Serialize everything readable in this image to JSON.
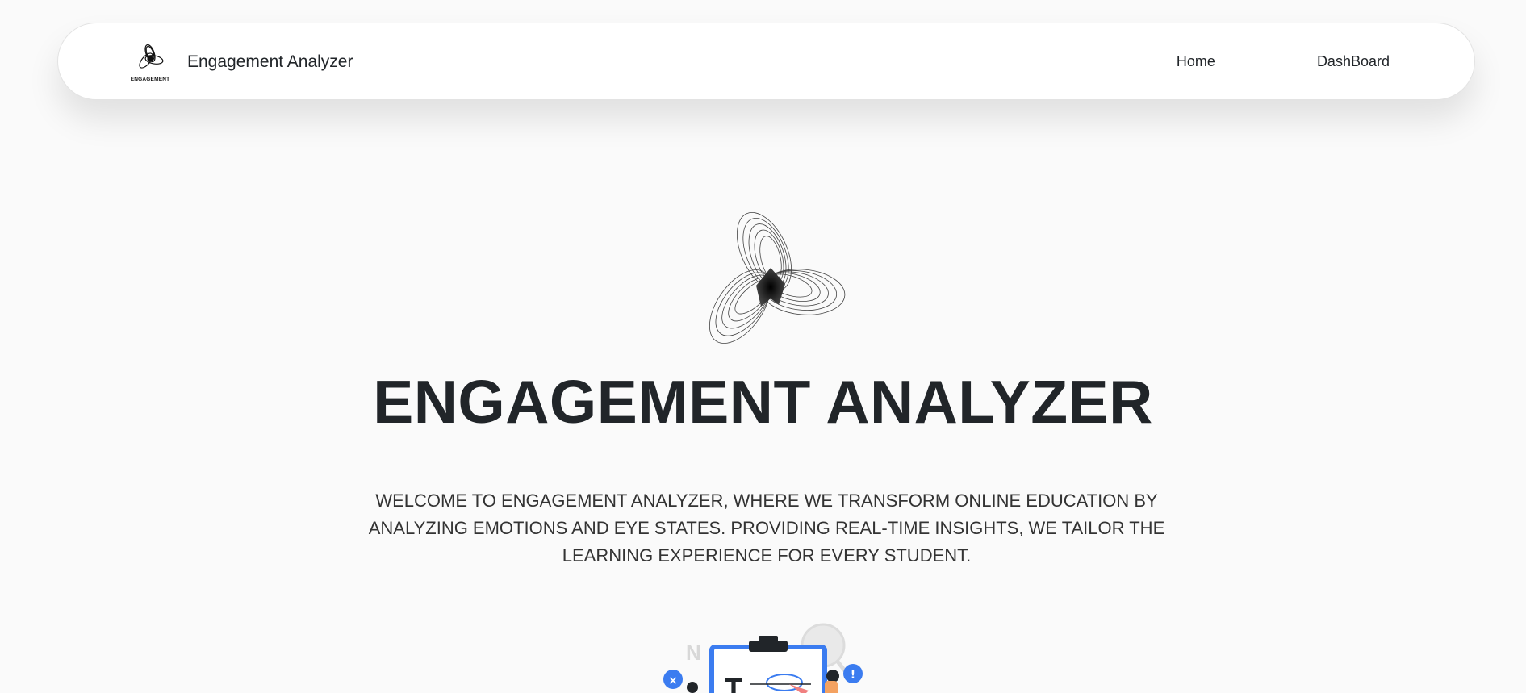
{
  "navbar": {
    "brand_logo_text": "ENGAGEMENT",
    "brand_name": "Engagement Analyzer",
    "links": [
      {
        "label": "Home"
      },
      {
        "label": "DashBoard"
      }
    ]
  },
  "hero": {
    "title": "ENGAGEMENT ANALYZER",
    "description": "WELCOME TO ENGAGEMENT ANALYZER, WHERE WE TRANSFORM ONLINE EDUCATION BY ANALYZING EMOTIONS AND EYE STATES. PROVIDING REAL-TIME INSIGHTS, WE TAILOR THE LEARNING EXPERIENCE FOR EVERY STUDENT."
  },
  "illustration": {
    "letters": [
      "N",
      "T"
    ],
    "badges": [
      "×",
      "!"
    ]
  },
  "colors": {
    "background": "#fafafa",
    "navbar": "#ffffff",
    "text": "#212529",
    "accent_blue": "#3b7cf0"
  },
  "icons": {
    "brand_logo": "spiral-triskelion-logo",
    "hero_logo": "spiral-triskelion-logo",
    "illustration": "clipboard-analysis-illustration"
  }
}
